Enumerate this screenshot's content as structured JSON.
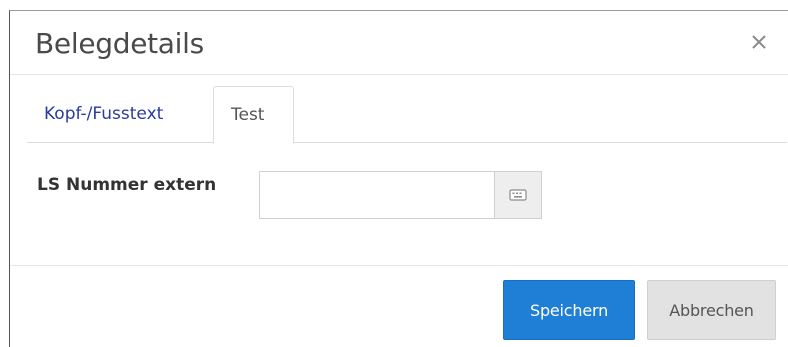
{
  "dialog": {
    "title": "Belegdetails",
    "close_icon": "close-icon",
    "tabs": [
      {
        "label": "Kopf-/Fusstext",
        "active": false
      },
      {
        "label": "Test",
        "active": true
      }
    ],
    "field": {
      "label": "LS Nummer extern",
      "value": "",
      "addon_icon": "keyboard-icon"
    },
    "buttons": {
      "save_label": "Speichern",
      "cancel_label": "Abbrechen"
    }
  },
  "colors": {
    "primary": "#1f7fd6",
    "link": "#2b3b9a",
    "secondary_button": "#e2e2e2"
  }
}
